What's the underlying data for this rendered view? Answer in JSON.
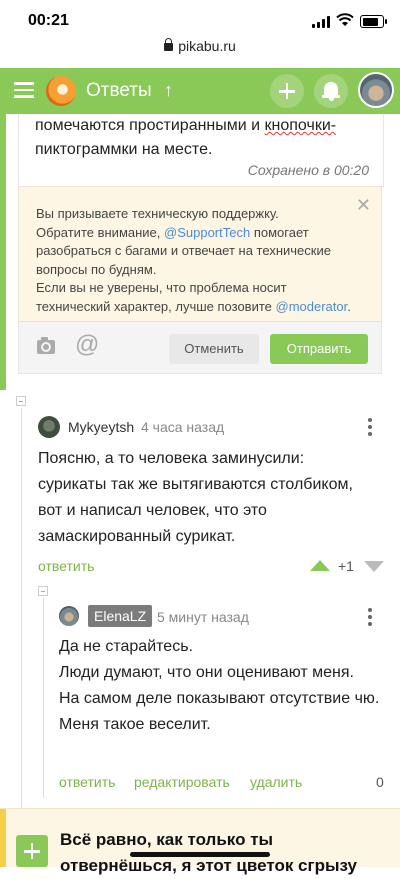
{
  "status_bar": {
    "time": "00:21"
  },
  "url_bar": {
    "domain": "pikabu.ru"
  },
  "header": {
    "title": "Ответы",
    "up_arrow": "↑"
  },
  "editor": {
    "text_before": "помечаются простиранными и ",
    "text_squiggle": "кнопочки-",
    "text_after": "пиктограммки на месте.",
    "saved_status": "Сохранено в 00:20"
  },
  "notice": {
    "line1": "Вы призываете техническую поддержку.",
    "line2_before": "Обратите внимание, ",
    "support_mention": "@SupportTech",
    "line2_after": " помогает разобраться с багами и отвечает на технические вопросы по будням.",
    "line3_before": "Если вы не уверены, что проблема носит технический характер, лучше позовите ",
    "moderator_mention": "@moderator",
    "line3_after": ".",
    "close_glyph": "✕"
  },
  "toolbar": {
    "at_glyph": "@",
    "cancel_label": "Отменить",
    "send_label": "Отправить"
  },
  "comment1": {
    "username": "Mykyeytsh",
    "time": "4 часа назад",
    "body": "Поясню, а то человека заминусили: сурикаты так же вытягиваются столбиком, вот и написал человек, что это замаскированный сурикат.",
    "reply_label": "ответить",
    "score": "+1"
  },
  "comment2": {
    "username": "ElenaLZ",
    "time": "5 минут назад",
    "line1": "Да не старайтесь.",
    "line2": "Люди думают, что они оценивают меня.",
    "line3": "На самом деле показывают отсутствие чю.",
    "line4": "Меня такое веселит.",
    "reply_label": "ответить",
    "edit_label": "редактировать",
    "delete_label": "удалить",
    "score": "0"
  },
  "post": {
    "title": "Всё равно, как только ты отвернёшься, я этот цветок сгрызу"
  },
  "colors": {
    "brand_green": "#8ac858",
    "link_blue": "#4d8bcf",
    "notice_bg": "#fef6e4"
  }
}
